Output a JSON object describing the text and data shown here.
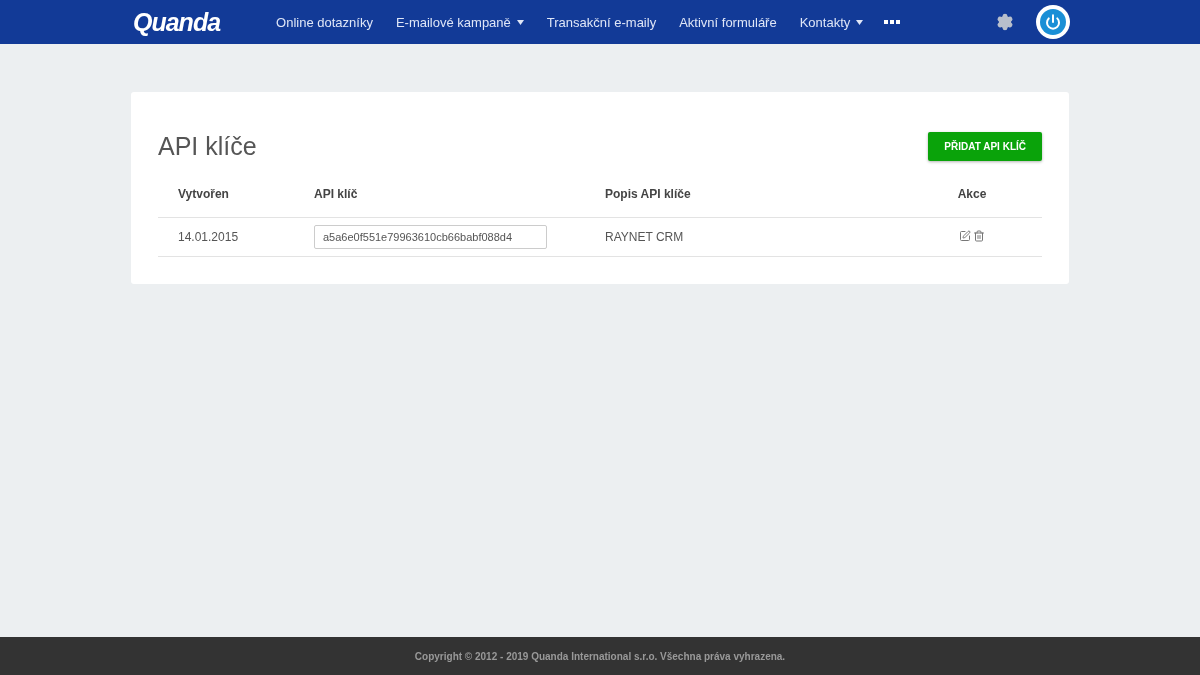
{
  "header": {
    "logo": "Quanda",
    "nav": [
      {
        "label": "Online dotazníky",
        "dropdown": false
      },
      {
        "label": "E-mailové kampaně",
        "dropdown": true
      },
      {
        "label": "Transakční e-maily",
        "dropdown": false
      },
      {
        "label": "Aktivní formuláře",
        "dropdown": false
      },
      {
        "label": "Kontakty",
        "dropdown": true
      }
    ]
  },
  "page": {
    "title": "API klíče",
    "add_button": "PŘIDAT API KLÍČ",
    "table": {
      "columns": [
        "Vytvořen",
        "API klíč",
        "Popis API klíče",
        "Akce"
      ],
      "rows": [
        {
          "created": "14.01.2015",
          "key": "a5a6e0f551e79963610cb66babf088d4",
          "description": "RAYNET CRM"
        }
      ]
    }
  },
  "footer": "Copyright © 2012 - 2019 Quanda International s.r.o. Všechna práva vyhrazena."
}
